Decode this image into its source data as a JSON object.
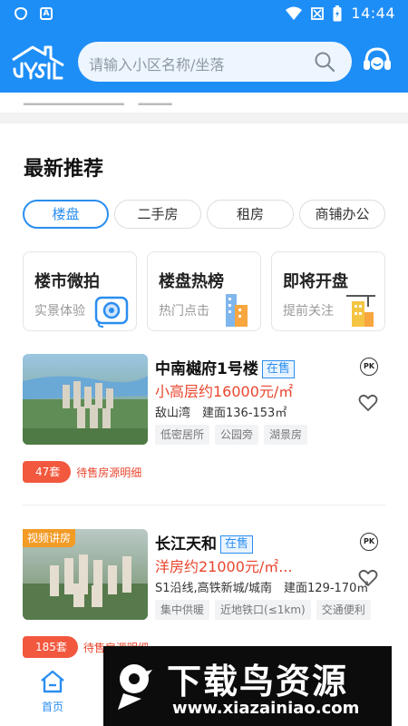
{
  "status_bar": {
    "time": "14:44",
    "app_icon_letter": "A"
  },
  "header": {
    "search_placeholder": "请输入小区名称/坐落",
    "brand_color": "#1e8ef7"
  },
  "section": {
    "title": "最新推荐"
  },
  "tabs": [
    {
      "label": "楼盘",
      "active": true
    },
    {
      "label": "二手房",
      "active": false
    },
    {
      "label": "租房",
      "active": false
    },
    {
      "label": "商铺办公",
      "active": false
    }
  ],
  "features": [
    {
      "title": "楼市微拍",
      "subtitle": "实景体验",
      "icon": "camera-icon"
    },
    {
      "title": "楼盘热榜",
      "subtitle": "热门点击",
      "icon": "building-icon"
    },
    {
      "title": "即将开盘",
      "subtitle": "提前关注",
      "icon": "construction-icon"
    }
  ],
  "listings": [
    {
      "name": "中南樾府1号楼",
      "status": "在售",
      "price": "小高层约16000元/㎡",
      "info": "敌山湾　建面136-153㎡",
      "tags": [
        "低密居所",
        "公园旁",
        "湖景房"
      ],
      "count": "47套",
      "count_label": "待售房源明细",
      "badge": ""
    },
    {
      "name": "长江天和",
      "status": "在售",
      "price": "洋房约21000元/㎡...",
      "info": "S1沿线,高铁新城/城南　建面129-170㎡",
      "tags": [
        "集中供暖",
        "近地铁口(≤1km)",
        "交通便利"
      ],
      "count": "185套",
      "count_label": "待售房源明细",
      "badge": "视频讲房"
    }
  ],
  "pk_label": "PK",
  "bottom_nav": {
    "home_label": "首页"
  },
  "watermark": {
    "title": "下载鸟资源",
    "url": "www.xiazainiao.com"
  },
  "colors": {
    "accent": "#2b8ef0",
    "price": "#e8452d",
    "count_bg": "#f2583e",
    "video_badge": "#f29b25"
  }
}
